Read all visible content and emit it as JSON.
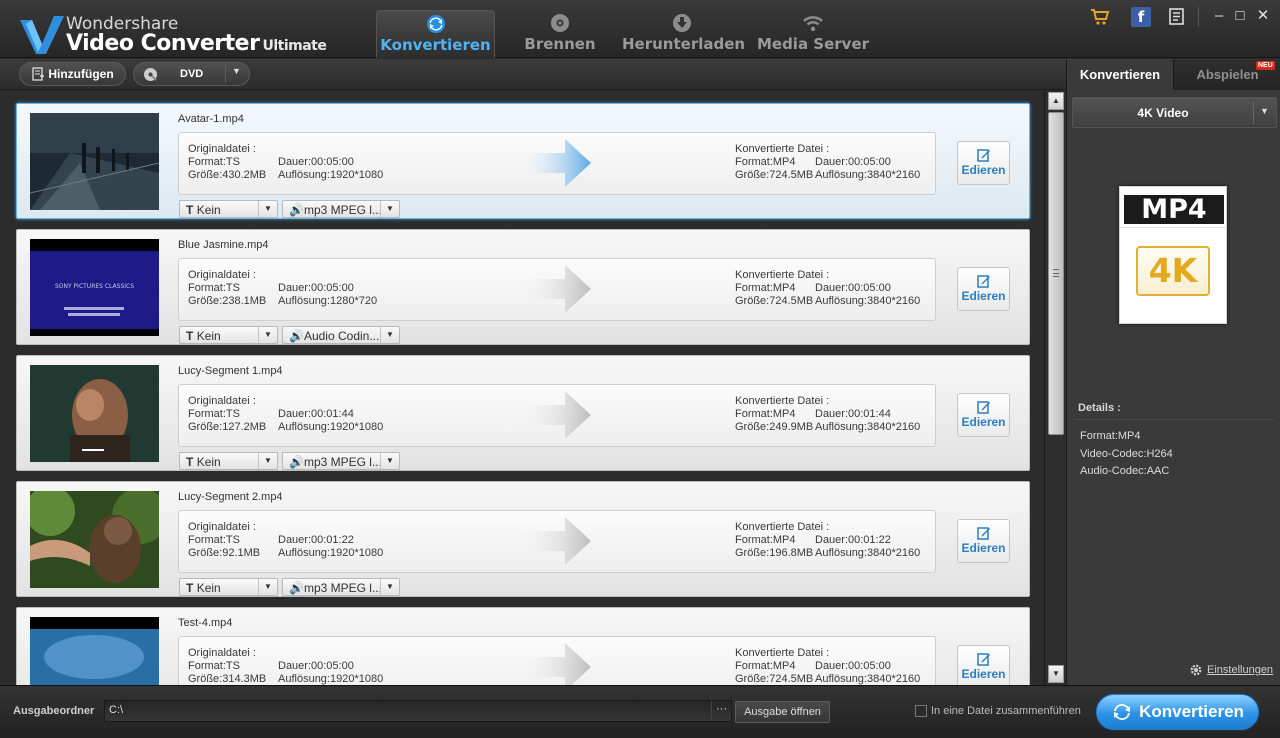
{
  "app": {
    "brand_top": "Wondershare",
    "brand_main": "Video Converter",
    "brand_sub": "Ultimate",
    "tabs": [
      {
        "label": "Konvertieren",
        "icon": "refresh-icon",
        "active": true
      },
      {
        "label": "Brennen",
        "icon": "disc-icon"
      },
      {
        "label": "Herunterladen",
        "icon": "download-icon"
      },
      {
        "label": "Media Server",
        "icon": "wifi-icon"
      }
    ],
    "header_icons": [
      "cart-icon",
      "facebook-icon",
      "menu-icon"
    ],
    "facebook_glyph": "f",
    "window_buttons": {
      "minimize": "–",
      "maximize": "□",
      "close": "✕"
    }
  },
  "toolbar": {
    "add_label": "Hinzufügen",
    "dvd_label": "DVD",
    "dropdown_glyph": "▼"
  },
  "files": [
    {
      "name": "Avatar-1.mp4",
      "selected": true,
      "orig_title": "Originaldatei :",
      "orig_format": "Format:TS",
      "orig_size": "Größe:430.2MB",
      "orig_duration": "Dauer:00:05:00",
      "orig_resolution": "Auflösung:1920*1080",
      "conv_title": "Konvertierte Datei :",
      "conv_format": "Format:MP4",
      "conv_size": "Größe:724.5MB",
      "conv_duration": "Dauer:00:05:00",
      "conv_resolution": "Auflösung:3840*2160",
      "edit_label": "Edieren",
      "subtitle": "Kein",
      "audio": "mp3 MPEG l..."
    },
    {
      "name": "Blue Jasmine.mp4",
      "orig_title": "Originaldatei :",
      "orig_format": "Format:TS",
      "orig_size": "Größe:238.1MB",
      "orig_duration": "Dauer:00:05:00",
      "orig_resolution": "Auflösung:1280*720",
      "conv_title": "Konvertierte Datei :",
      "conv_format": "Format:MP4",
      "conv_size": "Größe:724.5MB",
      "conv_duration": "Dauer:00:05:00",
      "conv_resolution": "Auflösung:3840*2160",
      "edit_label": "Edieren",
      "subtitle": "Kein",
      "audio": "Audio Codin...",
      "thumb_caption": "SONY PICTURES CLASSICS"
    },
    {
      "name": "Lucy-Segment 1.mp4",
      "orig_title": "Originaldatei :",
      "orig_format": "Format:TS",
      "orig_size": "Größe:127.2MB",
      "orig_duration": "Dauer:00:01:44",
      "orig_resolution": "Auflösung:1920*1080",
      "conv_title": "Konvertierte Datei :",
      "conv_format": "Format:MP4",
      "conv_size": "Größe:249.9MB",
      "conv_duration": "Dauer:00:01:44",
      "conv_resolution": "Auflösung:3840*2160",
      "edit_label": "Edieren",
      "subtitle": "Kein",
      "audio": "mp3 MPEG l..."
    },
    {
      "name": "Lucy-Segment 2.mp4",
      "orig_title": "Originaldatei :",
      "orig_format": "Format:TS",
      "orig_size": "Größe:92.1MB",
      "orig_duration": "Dauer:00:01:22",
      "orig_resolution": "Auflösung:1920*1080",
      "conv_title": "Konvertierte Datei :",
      "conv_format": "Format:MP4",
      "conv_size": "Größe:196.8MB",
      "conv_duration": "Dauer:00:01:22",
      "conv_resolution": "Auflösung:3840*2160",
      "edit_label": "Edieren",
      "subtitle": "Kein",
      "audio": "mp3 MPEG l..."
    },
    {
      "name": "Test-4.mp4",
      "orig_title": "Originaldatei :",
      "orig_format": "Format:TS",
      "orig_size": "Größe:314.3MB",
      "orig_duration": "Dauer:00:05:00",
      "orig_resolution": "Auflösung:1920*1080",
      "conv_title": "Konvertierte Datei :",
      "conv_format": "Format:MP4",
      "conv_size": "Größe:724.5MB",
      "conv_duration": "Dauer:00:05:00",
      "conv_resolution": "Auflösung:3840*2160",
      "edit_label": "Edieren"
    }
  ],
  "right_panel": {
    "tab_convert": "Konvertieren",
    "tab_play": "Abspielen",
    "new_badge": "NEU",
    "format_select": "4K Video",
    "format_icon_top": "MP4",
    "format_icon_badge": "4K",
    "details_title": "Details :",
    "details": [
      "Format:MP4",
      "Video-Codec:H264",
      "Audio-Codec:AAC"
    ],
    "settings_label": "Einstellungen"
  },
  "bottom": {
    "output_label": "Ausgabeordner",
    "output_path": "C:\\",
    "browse_glyph": "···",
    "open_label": "Ausgabe öffnen",
    "merge_label": "In eine Datei zusammenführen",
    "merge_checked": false,
    "convert_label": "Konvertieren"
  },
  "colors": {
    "accent_blue": "#4fb3f5",
    "convert_button": "#2d93e8",
    "new_badge": "#d42a1a",
    "format_4k_gold": "#e4a91f"
  }
}
